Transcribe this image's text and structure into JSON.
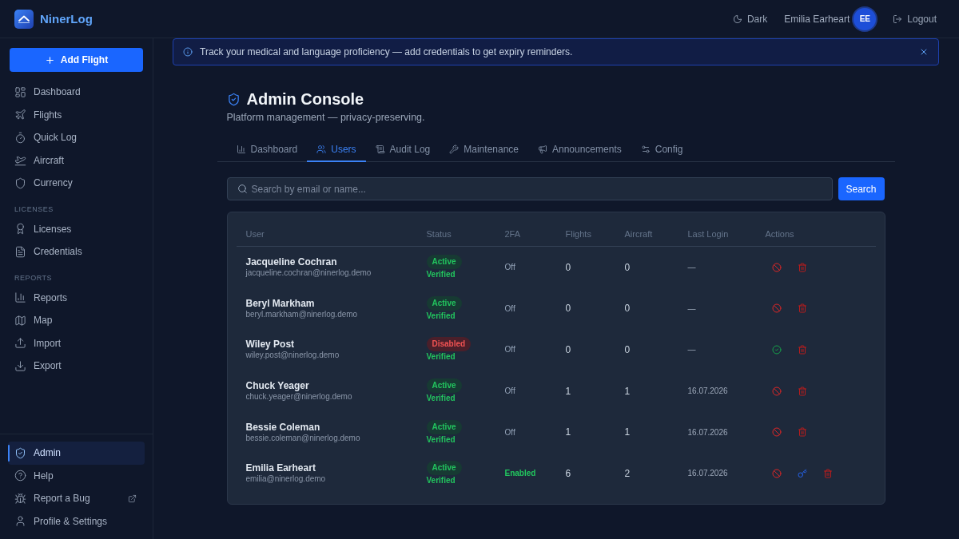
{
  "app": {
    "name": "NinerLog"
  },
  "header": {
    "theme_toggle": "Dark",
    "user": {
      "name": "Emilia Earheart",
      "initials": "EE"
    },
    "logout": "Logout"
  },
  "sidebar": {
    "primary_action": "Add Flight",
    "groups": [
      {
        "items": [
          {
            "label": "Dashboard",
            "selected": false
          },
          {
            "label": "Flights",
            "selected": false
          },
          {
            "label": "Quick Log",
            "selected": false
          },
          {
            "label": "Aircraft",
            "selected": false
          },
          {
            "label": "Currency",
            "selected": false
          }
        ]
      },
      {
        "heading": "LICENSES",
        "items": [
          {
            "label": "Licenses",
            "selected": false
          },
          {
            "label": "Credentials",
            "selected": false
          }
        ]
      },
      {
        "heading": "REPORTS",
        "items": [
          {
            "label": "Reports",
            "selected": false
          },
          {
            "label": "Map",
            "selected": false
          },
          {
            "label": "Import",
            "selected": false
          },
          {
            "label": "Export",
            "selected": false
          }
        ]
      }
    ],
    "footer_items": [
      {
        "label": "Admin",
        "selected": true,
        "external": false
      },
      {
        "label": "Help",
        "selected": false,
        "external": false
      },
      {
        "label": "Report a Bug",
        "selected": false,
        "external": true
      },
      {
        "label": "Profile & Settings",
        "selected": false,
        "external": false
      }
    ]
  },
  "banner": {
    "text": "Track your medical and language proficiency — add credentials to get expiry reminders."
  },
  "page": {
    "title": "Admin Console",
    "subtitle": "Platform management — privacy-preserving."
  },
  "tabs": [
    {
      "label": "Dashboard",
      "selected": false
    },
    {
      "label": "Users",
      "selected": true
    },
    {
      "label": "Audit Log",
      "selected": false
    },
    {
      "label": "Maintenance",
      "selected": false
    },
    {
      "label": "Announcements",
      "selected": false
    },
    {
      "label": "Config",
      "selected": false
    }
  ],
  "search": {
    "placeholder": "Search by email or name...",
    "button": "Search"
  },
  "table": {
    "columns": [
      "User",
      "Status",
      "2FA",
      "Flights",
      "Aircraft",
      "Last Login",
      "Actions"
    ],
    "rows": [
      {
        "name": "Jacqueline Cochran",
        "email": "jacqueline.cochran@ninerlog.demo",
        "status": {
          "label": "Active",
          "kind": "active"
        },
        "verification": "Verified",
        "two_factor": {
          "label": "Off",
          "enabled": false
        },
        "flights": "0",
        "aircraft": "0",
        "last_login": "—",
        "actions": [
          {
            "kind": "block"
          },
          {
            "kind": "delete"
          }
        ]
      },
      {
        "name": "Beryl Markham",
        "email": "beryl.markham@ninerlog.demo",
        "status": {
          "label": "Active",
          "kind": "active"
        },
        "verification": "Verified",
        "two_factor": {
          "label": "Off",
          "enabled": false
        },
        "flights": "0",
        "aircraft": "0",
        "last_login": "—",
        "actions": [
          {
            "kind": "block"
          },
          {
            "kind": "delete"
          }
        ]
      },
      {
        "name": "Wiley Post",
        "email": "wiley.post@ninerlog.demo",
        "status": {
          "label": "Disabled",
          "kind": "disabled"
        },
        "verification": "Verified",
        "two_factor": {
          "label": "Off",
          "enabled": false
        },
        "flights": "0",
        "aircraft": "0",
        "last_login": "—",
        "actions": [
          {
            "kind": "enable"
          },
          {
            "kind": "delete"
          }
        ]
      },
      {
        "name": "Chuck Yeager",
        "email": "chuck.yeager@ninerlog.demo",
        "status": {
          "label": "Active",
          "kind": "active"
        },
        "verification": "Verified",
        "two_factor": {
          "label": "Off",
          "enabled": false
        },
        "flights": "1",
        "aircraft": "1",
        "last_login": "16.07.2026",
        "actions": [
          {
            "kind": "block"
          },
          {
            "kind": "delete"
          }
        ]
      },
      {
        "name": "Bessie Coleman",
        "email": "bessie.coleman@ninerlog.demo",
        "status": {
          "label": "Active",
          "kind": "active"
        },
        "verification": "Verified",
        "two_factor": {
          "label": "Off",
          "enabled": false
        },
        "flights": "1",
        "aircraft": "1",
        "last_login": "16.07.2026",
        "actions": [
          {
            "kind": "block"
          },
          {
            "kind": "delete"
          }
        ]
      },
      {
        "name": "Emilia Earheart",
        "email": "emilia@ninerlog.demo",
        "status": {
          "label": "Active",
          "kind": "active"
        },
        "verification": "Verified",
        "two_factor": {
          "label": "Enabled",
          "enabled": true
        },
        "flights": "6",
        "aircraft": "2",
        "last_login": "16.07.2026",
        "actions": [
          {
            "kind": "block"
          },
          {
            "kind": "reset_key"
          },
          {
            "kind": "delete"
          }
        ]
      }
    ]
  }
}
